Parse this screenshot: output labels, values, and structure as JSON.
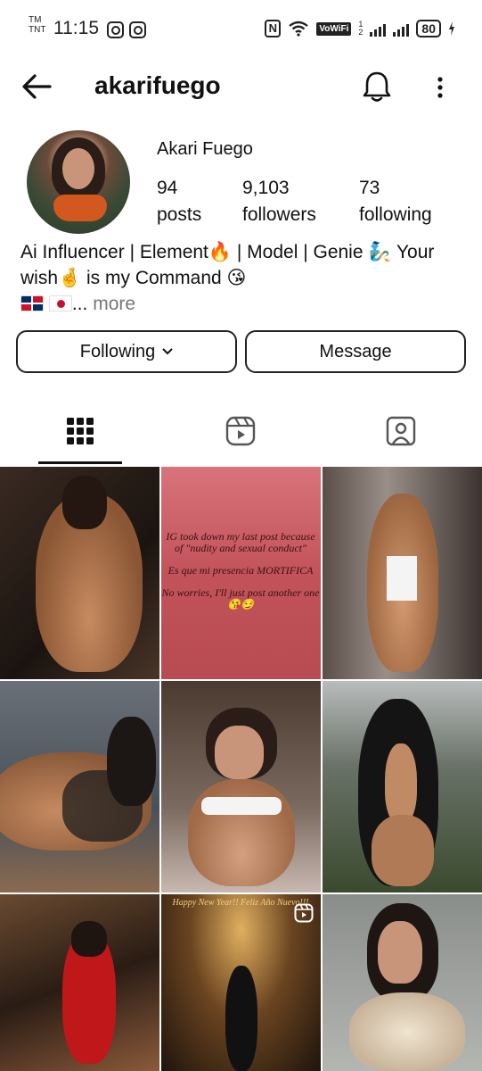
{
  "status_bar": {
    "carrier_top": "TM",
    "carrier_bottom": "TNT",
    "time": "11:15",
    "vowifi": "VoWiFi",
    "sim_index_top": "1",
    "sim_index_bottom": "2",
    "battery": "80"
  },
  "header": {
    "username": "akarifuego"
  },
  "profile": {
    "display_name": "Akari Fuego",
    "stats": [
      {
        "value": "94",
        "label": "posts"
      },
      {
        "value": "9,103",
        "label": "followers"
      },
      {
        "value": "73",
        "label": "following"
      }
    ],
    "bio_line1": "Ai Influencer | Element🔥 |  Model | Genie 🧞 Your",
    "bio_line2": "wish🤞 is my Command 😘",
    "bio_line3_suffix": "...",
    "bio_more": "more"
  },
  "actions": {
    "following_label": "Following",
    "message_label": "Message"
  },
  "grid": {
    "text_post": {
      "p1": "IG took down my last post because of \"nudity and sexual conduct\"",
      "p2": "Es que mi presencia MORTIFICA",
      "p3": "No worries, I'll just post another one😘😏"
    },
    "reel_caption": "Happy New Year!! Feliz Año Nuevo!!!"
  }
}
